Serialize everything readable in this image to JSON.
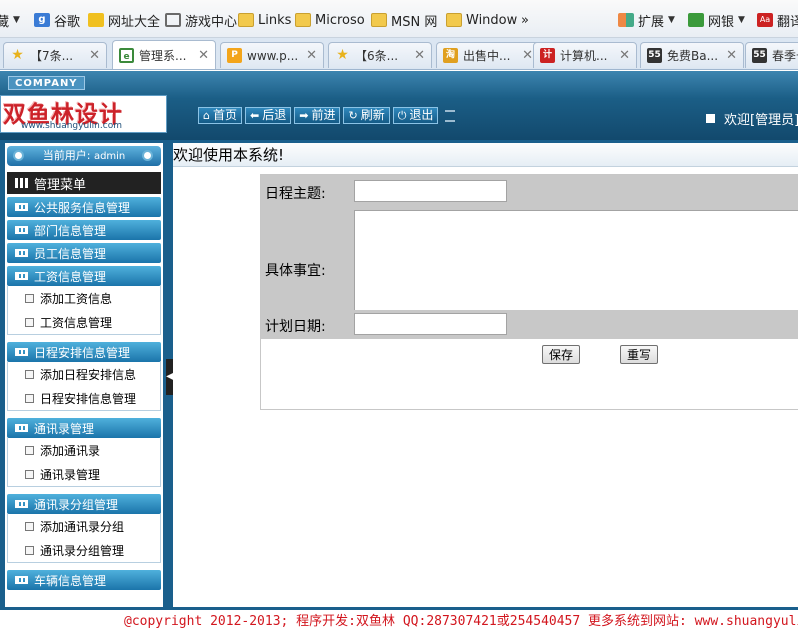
{
  "bookmarks": [
    {
      "label": "藏",
      "icon": "dropdown-arrow"
    },
    {
      "label": "谷歌",
      "icon": "google-icon"
    },
    {
      "label": "网址大全",
      "icon": "site-nav-icon"
    },
    {
      "label": "游戏中心",
      "icon": "game-icon"
    },
    {
      "label": "Links",
      "icon": "folder-icon"
    },
    {
      "label": "Microso",
      "icon": "folder-icon"
    },
    {
      "label": "MSN 网",
      "icon": "folder-icon"
    },
    {
      "label": "Window",
      "icon": "folder-icon"
    },
    {
      "label": "»",
      "icon": "more-icon"
    },
    {
      "label": "扩展",
      "icon": "extension-icon"
    },
    {
      "label": "网银",
      "icon": "bank-icon"
    },
    {
      "label": "翻译",
      "icon": "translate-icon"
    }
  ],
  "tabs": [
    {
      "label": "【7条..."
    },
    {
      "label": "管理系..."
    },
    {
      "label": "www.p..."
    },
    {
      "label": "【6条..."
    },
    {
      "label": "出售中..."
    },
    {
      "label": "计算机..."
    },
    {
      "label": "免费Ba..."
    },
    {
      "label": "春季卡"
    }
  ],
  "header": {
    "company": "COMPANY",
    "logo_text": "双鱼林设计",
    "logo_url": "www.shuangyulin.com",
    "nav": [
      "首页",
      "后退",
      "前进",
      "刷新",
      "退出"
    ],
    "welcome": "欢迎[管理员]"
  },
  "sidebar": {
    "current_user_label": "当前用户:",
    "current_user": "admin",
    "menu_title": "管理菜单",
    "groups": [
      {
        "title": "公共服务信息管理",
        "items": []
      },
      {
        "title": "部门信息管理",
        "items": []
      },
      {
        "title": "员工信息管理",
        "items": []
      },
      {
        "title": "工资信息管理",
        "items": [
          "添加工资信息",
          "工资信息管理"
        ]
      },
      {
        "title": "日程安排信息管理",
        "items": [
          "添加日程安排信息",
          "日程安排信息管理"
        ]
      },
      {
        "title": "通讯录管理",
        "items": [
          "添加通讯录",
          "通讯录管理"
        ]
      },
      {
        "title": "通讯录分组管理",
        "items": [
          "添加通讯录分组",
          "通讯录分组管理"
        ]
      },
      {
        "title": "车辆信息管理",
        "items": []
      }
    ]
  },
  "main": {
    "welcome_title": "欢迎使用本系统!",
    "form": {
      "subject_label": "日程主题:",
      "subject_value": "",
      "detail_label": "具体事宜:",
      "detail_value": "",
      "date_label": "计划日期:",
      "date_value": "",
      "save_button": "保存",
      "reset_button": "重写"
    }
  },
  "footer": {
    "text": "@copyright 2012-2013; 程序开发:双鱼林  QQ:287307421或254540457  更多系统到网站: www.shuangyulin.com"
  },
  "colors": {
    "frame_blue": "#1a5f8c",
    "footer_red": "#d2161e",
    "logo_red": "#cc2229",
    "form_gray": "#c8c8c8"
  }
}
